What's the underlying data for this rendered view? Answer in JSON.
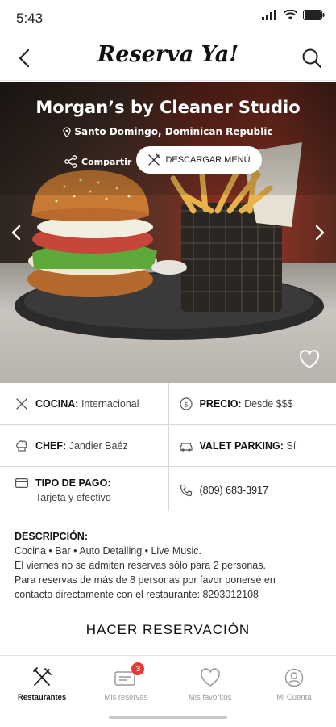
{
  "status_bar": {
    "time": "5:43"
  },
  "header": {
    "title": "Reserva Ya!"
  },
  "restaurant": {
    "name": "Morgan’s by Cleaner Studio",
    "location": "Santo Domingo, Dominican Republic",
    "share_label": "Compartir",
    "menu_label": "DESCARGAR MENÚ"
  },
  "info": {
    "cocina": {
      "label": "COCINA:",
      "value": "Internacional"
    },
    "precio": {
      "label": "PRECIO:",
      "value": "Desde $$$"
    },
    "chef": {
      "label": "CHEF:",
      "value": "Jandier Baéz"
    },
    "valet": {
      "label": "VALET PARKING:",
      "value": "Sí"
    },
    "pago": {
      "label": "TIPO DE PAGO:",
      "value": "Tarjeta y efectivo"
    },
    "telefono": {
      "value": "(809) 683-3917"
    }
  },
  "description": {
    "title": "DESCRIPCIÓN:",
    "line1": "Cocina • Bar • Auto Detailing • Live Music.",
    "line2": "El viernes no se admiten reservas sólo para 2 personas.",
    "line3": "Para reservas de más de 8 personas por favor ponerse en",
    "line4": "contacto directamente con el restaurante: 8293012108"
  },
  "reserve_button": "HACER RESERVACIÓN",
  "bottom_nav": {
    "items": [
      {
        "label": "Restaurantes",
        "icon": "fork-knife-icon"
      },
      {
        "label": "Mis reservas",
        "icon": "ticket-icon",
        "badge": "3"
      },
      {
        "label": "Mis favoritos",
        "icon": "heart-icon"
      },
      {
        "label": "Mi Cuenta",
        "icon": "user-icon"
      }
    ]
  }
}
